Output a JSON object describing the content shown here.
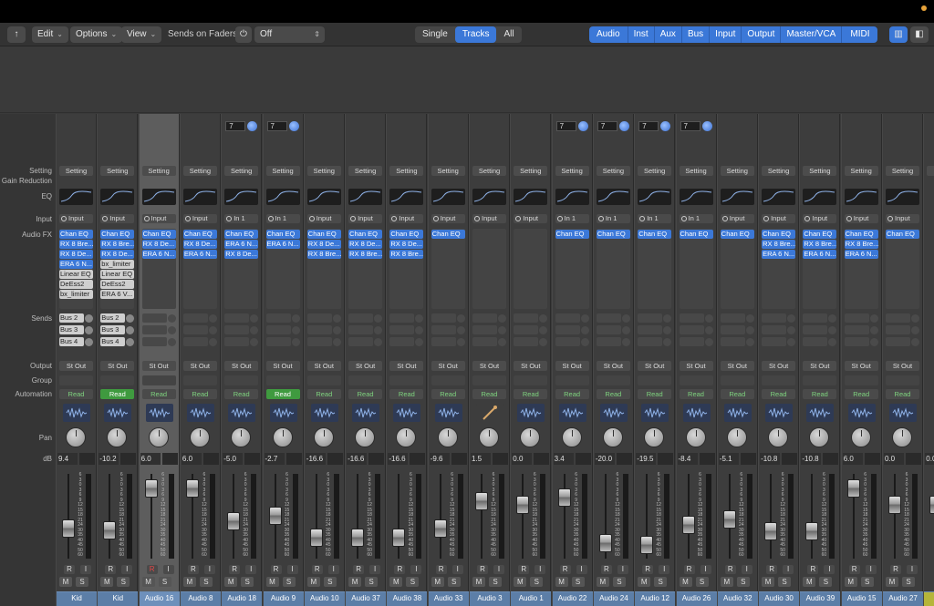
{
  "toolbar": {
    "back_icon": "return-arrow-icon",
    "edit": "Edit",
    "options": "Options",
    "view": "View",
    "sends_label": "Sends on Faders:",
    "sends_value": "Off",
    "view_modes": [
      "Single",
      "Tracks",
      "All"
    ],
    "active_view_mode": "Tracks",
    "filters": [
      "Audio",
      "Inst",
      "Aux",
      "Bus",
      "Input",
      "Output",
      "Master/VCA",
      "MIDI"
    ],
    "layout_icons": [
      "mixer-layout-icon",
      "single-strip-icon"
    ]
  },
  "row_labels": {
    "setting": "Setting",
    "gain_reduction": "Gain Reduction",
    "eq": "EQ",
    "input": "Input",
    "audio_fx": "Audio FX",
    "sends": "Sends",
    "output": "Output",
    "group": "Group",
    "automation": "Automation",
    "pan": "Pan",
    "db": "dB"
  },
  "strips": [
    {
      "name": "Kid",
      "setting": "Setting",
      "input": "Input",
      "fx": [
        "Chan EQ",
        "RX 8 Bre...",
        "RX 8 De...",
        "ERA 6 N...",
        "Linear EQ",
        "DeEss2",
        "bx_limiter"
      ],
      "fx_cut": true,
      "sends": [
        "Bus 2",
        "Bus 3",
        "Bus 4"
      ],
      "output": "St Out",
      "automation": "Read",
      "auto_on": false,
      "db": "9.4",
      "fader": 0.38,
      "num": "",
      "sel": false
    },
    {
      "name": "Kid",
      "setting": "Setting",
      "input": "Input",
      "fx": [
        "Chan EQ",
        "RX 8 Bre...",
        "RX 8 De...",
        "bx_limiter",
        "Linear EQ",
        "DeEss2",
        "ERA 6 V..."
      ],
      "fx_cut": false,
      "sends": [
        "Bus 2",
        "Bus 3",
        "Bus 4"
      ],
      "output": "St Out",
      "automation": "Read",
      "auto_on": true,
      "db": "-10.2",
      "fader": 0.35,
      "num": "",
      "sel": false
    },
    {
      "name": "Audio 16",
      "setting": "Setting",
      "input": "Input",
      "fx": [
        "Chan EQ",
        "RX 8 De...",
        "ERA 6 N..."
      ],
      "fx_cut": false,
      "sends": [],
      "output": "St Out",
      "automation": "Read",
      "auto_on": false,
      "db": "6.0",
      "fader": 0.92,
      "num": "",
      "sel": true,
      "rec": true
    },
    {
      "name": "Audio 8",
      "setting": "Setting",
      "input": "Input",
      "fx": [
        "Chan EQ",
        "RX 8 De...",
        "ERA 6 N..."
      ],
      "fx_cut": false,
      "sends": [],
      "output": "St Out",
      "automation": "Read",
      "auto_on": false,
      "db": "6.0",
      "fader": 0.92,
      "num": "",
      "sel": false
    },
    {
      "name": "Audio 18",
      "setting": "Setting",
      "input": "In 1",
      "fx": [
        "Chan EQ",
        "ERA 6 N...",
        "RX 8 De..."
      ],
      "fx_cut": false,
      "sends": [],
      "output": "St Out",
      "automation": "Read",
      "auto_on": false,
      "db": "-5.0",
      "fader": 0.48,
      "num": "7",
      "sel": false
    },
    {
      "name": "Audio 9",
      "setting": "Setting",
      "input": "In 1",
      "fx": [
        "Chan EQ",
        "ERA 6 N..."
      ],
      "fx_cut": false,
      "sends": [],
      "output": "St Out",
      "automation": "Read",
      "auto_on": true,
      "db": "-2.7",
      "fader": 0.55,
      "num": "7",
      "sel": false
    },
    {
      "name": "Audio 10",
      "setting": "Setting",
      "input": "Input",
      "fx": [
        "Chan EQ",
        "RX 8 De...",
        "RX 8 Bre..."
      ],
      "fx_cut": false,
      "sends": [],
      "output": "St Out",
      "automation": "Read",
      "auto_on": false,
      "db": "-16.6",
      "fader": 0.25,
      "num": "",
      "sel": false
    },
    {
      "name": "Audio 37",
      "setting": "Setting",
      "input": "Input",
      "fx": [
        "Chan EQ",
        "RX 8 De...",
        "RX 8 Bre..."
      ],
      "fx_cut": false,
      "sends": [],
      "output": "St Out",
      "automation": "Read",
      "auto_on": false,
      "db": "-16.6",
      "fader": 0.25,
      "num": "",
      "sel": false
    },
    {
      "name": "Audio 38",
      "setting": "Setting",
      "input": "Input",
      "fx": [
        "Chan EQ",
        "RX 8 De...",
        "RX 8 Bre..."
      ],
      "fx_cut": false,
      "sends": [],
      "output": "St Out",
      "automation": "Read",
      "auto_on": false,
      "db": "-16.6",
      "fader": 0.25,
      "num": "",
      "sel": false
    },
    {
      "name": "Audio 33",
      "setting": "Setting",
      "input": "Input",
      "fx": [
        "Chan EQ"
      ],
      "fx_cut": false,
      "sends": [],
      "output": "St Out",
      "automation": "Read",
      "auto_on": false,
      "db": "-9.6",
      "fader": 0.38,
      "num": "",
      "sel": false
    },
    {
      "name": "Audio 3",
      "setting": "Setting",
      "input": "Input",
      "fx": [],
      "fx_cut": false,
      "sends": [],
      "output": "St Out",
      "automation": "Read",
      "auto_on": false,
      "db": "1.5",
      "fader": 0.75,
      "num": "",
      "sel": false,
      "horn": true
    },
    {
      "name": "Audio 1",
      "setting": "Setting",
      "input": "Input",
      "fx": [],
      "fx_cut": false,
      "sends": [],
      "output": "St Out",
      "automation": "Read",
      "auto_on": false,
      "db": "0.0",
      "fader": 0.7,
      "num": "",
      "sel": false
    },
    {
      "name": "Audio 22",
      "setting": "Setting",
      "input": "In 1",
      "fx": [
        "Chan EQ"
      ],
      "fx_cut": false,
      "sends": [],
      "output": "St Out",
      "automation": "Read",
      "auto_on": false,
      "db": "3.4",
      "fader": 0.8,
      "num": "7",
      "sel": false
    },
    {
      "name": "Audio 24",
      "setting": "Setting",
      "input": "In 1",
      "fx": [
        "Chan EQ"
      ],
      "fx_cut": false,
      "sends": [],
      "output": "St Out",
      "automation": "Read",
      "auto_on": false,
      "db": "-20.0",
      "fader": 0.18,
      "num": "7",
      "sel": false
    },
    {
      "name": "Audio 12",
      "setting": "Setting",
      "input": "In 1",
      "fx": [
        "Chan EQ"
      ],
      "fx_cut": false,
      "sends": [],
      "output": "St Out",
      "automation": "Read",
      "auto_on": false,
      "db": "-19.5",
      "fader": 0.15,
      "num": "7",
      "sel": false
    },
    {
      "name": "Audio 26",
      "setting": "Setting",
      "input": "In 1",
      "fx": [
        "Chan EQ"
      ],
      "fx_cut": false,
      "sends": [],
      "output": "St Out",
      "automation": "Read",
      "auto_on": false,
      "db": "-8.4",
      "fader": 0.42,
      "num": "7",
      "sel": false
    },
    {
      "name": "Audio 32",
      "setting": "Setting",
      "input": "Input",
      "fx": [
        "Chan EQ"
      ],
      "fx_cut": false,
      "sends": [],
      "output": "St Out",
      "automation": "Read",
      "auto_on": false,
      "db": "-5.1",
      "fader": 0.5,
      "num": "",
      "sel": false
    },
    {
      "name": "Audio 30",
      "setting": "Setting",
      "input": "Input",
      "fx": [
        "Chan EQ",
        "RX 8 Bre...",
        "ERA 6 N..."
      ],
      "fx_cut": false,
      "sends": [],
      "output": "St Out",
      "automation": "Read",
      "auto_on": false,
      "db": "-10.8",
      "fader": 0.34,
      "num": "",
      "sel": false
    },
    {
      "name": "Audio 39",
      "setting": "Setting",
      "input": "Input",
      "fx": [
        "Chan EQ",
        "RX 8 Bre...",
        "ERA 6 N..."
      ],
      "fx_cut": false,
      "sends": [],
      "output": "St Out",
      "automation": "Read",
      "auto_on": false,
      "db": "-10.8",
      "fader": 0.34,
      "num": "",
      "sel": false
    },
    {
      "name": "Audio 15",
      "setting": "Setting",
      "input": "Input",
      "fx": [
        "Chan EQ",
        "RX 8 Bre...",
        "ERA 6 N..."
      ],
      "fx_cut": false,
      "sends": [],
      "output": "St Out",
      "automation": "Read",
      "auto_on": false,
      "db": "6.0",
      "fader": 0.92,
      "num": "",
      "sel": false
    },
    {
      "name": "Audio 27",
      "setting": "Setting",
      "input": "Input",
      "fx": [
        "Chan EQ"
      ],
      "fx_cut": false,
      "sends": [],
      "output": "St Out",
      "automation": "Read",
      "auto_on": false,
      "db": "0.0",
      "fader": 0.7,
      "num": "",
      "sel": false
    },
    {
      "name": "",
      "setting": "Se",
      "input": "",
      "fx": [],
      "fx_cut": false,
      "sends": [],
      "output": "",
      "automation": "",
      "auto_on": false,
      "db": "0.0",
      "fader": 0.7,
      "num": "",
      "sel": false,
      "partial": true
    }
  ],
  "fader_scale": [
    "6",
    "3",
    "0",
    "3",
    "6",
    "9",
    "12",
    "15",
    "18",
    "21",
    "24",
    "30",
    "35",
    "40",
    "45",
    "50",
    "60"
  ],
  "strip_controls": {
    "r": "R",
    "i": "I",
    "m": "M",
    "s": "S"
  },
  "colors": {
    "accent": "#3b78d8",
    "read_green": "#3f9a3f",
    "name_blue": "#5c7ea7",
    "record_red": "#e04848"
  }
}
